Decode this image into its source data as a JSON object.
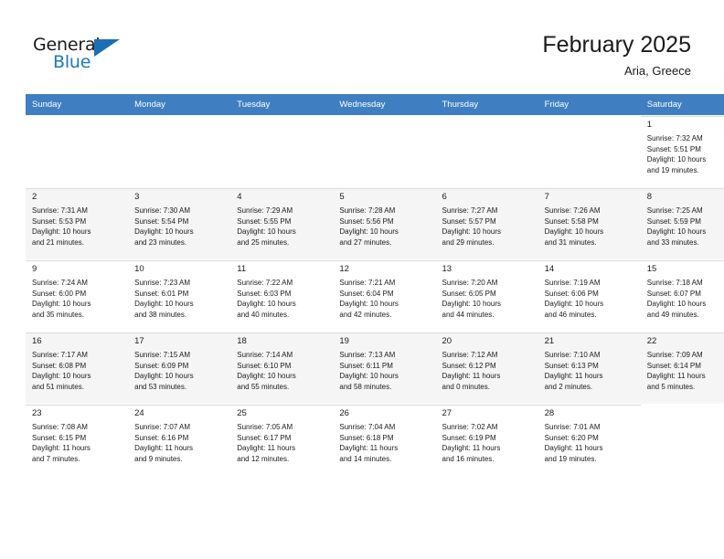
{
  "brand": {
    "name_part1": "General",
    "name_part2": "Blue",
    "accent_color": "#1c78c0"
  },
  "header": {
    "title": "February 2025",
    "location": "Aria, Greece"
  },
  "colors": {
    "header_row_bg": "#3f7fc1",
    "header_row_text": "#ffffff",
    "shaded_row_bg": "#f5f5f5",
    "cell_rule": "#d9d9d9"
  },
  "weekday_headers": [
    "Sunday",
    "Monday",
    "Tuesday",
    "Wednesday",
    "Thursday",
    "Friday",
    "Saturday"
  ],
  "weeks": [
    {
      "shaded": false,
      "days": [
        {
          "empty": true
        },
        {
          "empty": true
        },
        {
          "empty": true
        },
        {
          "empty": true
        },
        {
          "empty": true
        },
        {
          "empty": true
        },
        {
          "empty": false,
          "date": "1",
          "sunrise": "Sunrise: 7:32 AM",
          "sunset": "Sunset: 5:51 PM",
          "daylight1": "Daylight: 10 hours",
          "daylight2": "and 19 minutes."
        }
      ]
    },
    {
      "shaded": true,
      "days": [
        {
          "empty": false,
          "date": "2",
          "sunrise": "Sunrise: 7:31 AM",
          "sunset": "Sunset: 5:53 PM",
          "daylight1": "Daylight: 10 hours",
          "daylight2": "and 21 minutes."
        },
        {
          "empty": false,
          "date": "3",
          "sunrise": "Sunrise: 7:30 AM",
          "sunset": "Sunset: 5:54 PM",
          "daylight1": "Daylight: 10 hours",
          "daylight2": "and 23 minutes."
        },
        {
          "empty": false,
          "date": "4",
          "sunrise": "Sunrise: 7:29 AM",
          "sunset": "Sunset: 5:55 PM",
          "daylight1": "Daylight: 10 hours",
          "daylight2": "and 25 minutes."
        },
        {
          "empty": false,
          "date": "5",
          "sunrise": "Sunrise: 7:28 AM",
          "sunset": "Sunset: 5:56 PM",
          "daylight1": "Daylight: 10 hours",
          "daylight2": "and 27 minutes."
        },
        {
          "empty": false,
          "date": "6",
          "sunrise": "Sunrise: 7:27 AM",
          "sunset": "Sunset: 5:57 PM",
          "daylight1": "Daylight: 10 hours",
          "daylight2": "and 29 minutes."
        },
        {
          "empty": false,
          "date": "7",
          "sunrise": "Sunrise: 7:26 AM",
          "sunset": "Sunset: 5:58 PM",
          "daylight1": "Daylight: 10 hours",
          "daylight2": "and 31 minutes."
        },
        {
          "empty": false,
          "date": "8",
          "sunrise": "Sunrise: 7:25 AM",
          "sunset": "Sunset: 5:59 PM",
          "daylight1": "Daylight: 10 hours",
          "daylight2": "and 33 minutes."
        }
      ]
    },
    {
      "shaded": false,
      "days": [
        {
          "empty": false,
          "date": "9",
          "sunrise": "Sunrise: 7:24 AM",
          "sunset": "Sunset: 6:00 PM",
          "daylight1": "Daylight: 10 hours",
          "daylight2": "and 35 minutes."
        },
        {
          "empty": false,
          "date": "10",
          "sunrise": "Sunrise: 7:23 AM",
          "sunset": "Sunset: 6:01 PM",
          "daylight1": "Daylight: 10 hours",
          "daylight2": "and 38 minutes."
        },
        {
          "empty": false,
          "date": "11",
          "sunrise": "Sunrise: 7:22 AM",
          "sunset": "Sunset: 6:03 PM",
          "daylight1": "Daylight: 10 hours",
          "daylight2": "and 40 minutes."
        },
        {
          "empty": false,
          "date": "12",
          "sunrise": "Sunrise: 7:21 AM",
          "sunset": "Sunset: 6:04 PM",
          "daylight1": "Daylight: 10 hours",
          "daylight2": "and 42 minutes."
        },
        {
          "empty": false,
          "date": "13",
          "sunrise": "Sunrise: 7:20 AM",
          "sunset": "Sunset: 6:05 PM",
          "daylight1": "Daylight: 10 hours",
          "daylight2": "and 44 minutes."
        },
        {
          "empty": false,
          "date": "14",
          "sunrise": "Sunrise: 7:19 AM",
          "sunset": "Sunset: 6:06 PM",
          "daylight1": "Daylight: 10 hours",
          "daylight2": "and 46 minutes."
        },
        {
          "empty": false,
          "date": "15",
          "sunrise": "Sunrise: 7:18 AM",
          "sunset": "Sunset: 6:07 PM",
          "daylight1": "Daylight: 10 hours",
          "daylight2": "and 49 minutes."
        }
      ]
    },
    {
      "shaded": true,
      "days": [
        {
          "empty": false,
          "date": "16",
          "sunrise": "Sunrise: 7:17 AM",
          "sunset": "Sunset: 6:08 PM",
          "daylight1": "Daylight: 10 hours",
          "daylight2": "and 51 minutes."
        },
        {
          "empty": false,
          "date": "17",
          "sunrise": "Sunrise: 7:15 AM",
          "sunset": "Sunset: 6:09 PM",
          "daylight1": "Daylight: 10 hours",
          "daylight2": "and 53 minutes."
        },
        {
          "empty": false,
          "date": "18",
          "sunrise": "Sunrise: 7:14 AM",
          "sunset": "Sunset: 6:10 PM",
          "daylight1": "Daylight: 10 hours",
          "daylight2": "and 55 minutes."
        },
        {
          "empty": false,
          "date": "19",
          "sunrise": "Sunrise: 7:13 AM",
          "sunset": "Sunset: 6:11 PM",
          "daylight1": "Daylight: 10 hours",
          "daylight2": "and 58 minutes."
        },
        {
          "empty": false,
          "date": "20",
          "sunrise": "Sunrise: 7:12 AM",
          "sunset": "Sunset: 6:12 PM",
          "daylight1": "Daylight: 11 hours",
          "daylight2": "and 0 minutes."
        },
        {
          "empty": false,
          "date": "21",
          "sunrise": "Sunrise: 7:10 AM",
          "sunset": "Sunset: 6:13 PM",
          "daylight1": "Daylight: 11 hours",
          "daylight2": "and 2 minutes."
        },
        {
          "empty": false,
          "date": "22",
          "sunrise": "Sunrise: 7:09 AM",
          "sunset": "Sunset: 6:14 PM",
          "daylight1": "Daylight: 11 hours",
          "daylight2": "and 5 minutes."
        }
      ]
    },
    {
      "shaded": false,
      "days": [
        {
          "empty": false,
          "date": "23",
          "sunrise": "Sunrise: 7:08 AM",
          "sunset": "Sunset: 6:15 PM",
          "daylight1": "Daylight: 11 hours",
          "daylight2": "and 7 minutes."
        },
        {
          "empty": false,
          "date": "24",
          "sunrise": "Sunrise: 7:07 AM",
          "sunset": "Sunset: 6:16 PM",
          "daylight1": "Daylight: 11 hours",
          "daylight2": "and 9 minutes."
        },
        {
          "empty": false,
          "date": "25",
          "sunrise": "Sunrise: 7:05 AM",
          "sunset": "Sunset: 6:17 PM",
          "daylight1": "Daylight: 11 hours",
          "daylight2": "and 12 minutes."
        },
        {
          "empty": false,
          "date": "26",
          "sunrise": "Sunrise: 7:04 AM",
          "sunset": "Sunset: 6:18 PM",
          "daylight1": "Daylight: 11 hours",
          "daylight2": "and 14 minutes."
        },
        {
          "empty": false,
          "date": "27",
          "sunrise": "Sunrise: 7:02 AM",
          "sunset": "Sunset: 6:19 PM",
          "daylight1": "Daylight: 11 hours",
          "daylight2": "and 16 minutes."
        },
        {
          "empty": false,
          "date": "28",
          "sunrise": "Sunrise: 7:01 AM",
          "sunset": "Sunset: 6:20 PM",
          "daylight1": "Daylight: 11 hours",
          "daylight2": "and 19 minutes."
        },
        {
          "empty": true
        }
      ]
    }
  ]
}
